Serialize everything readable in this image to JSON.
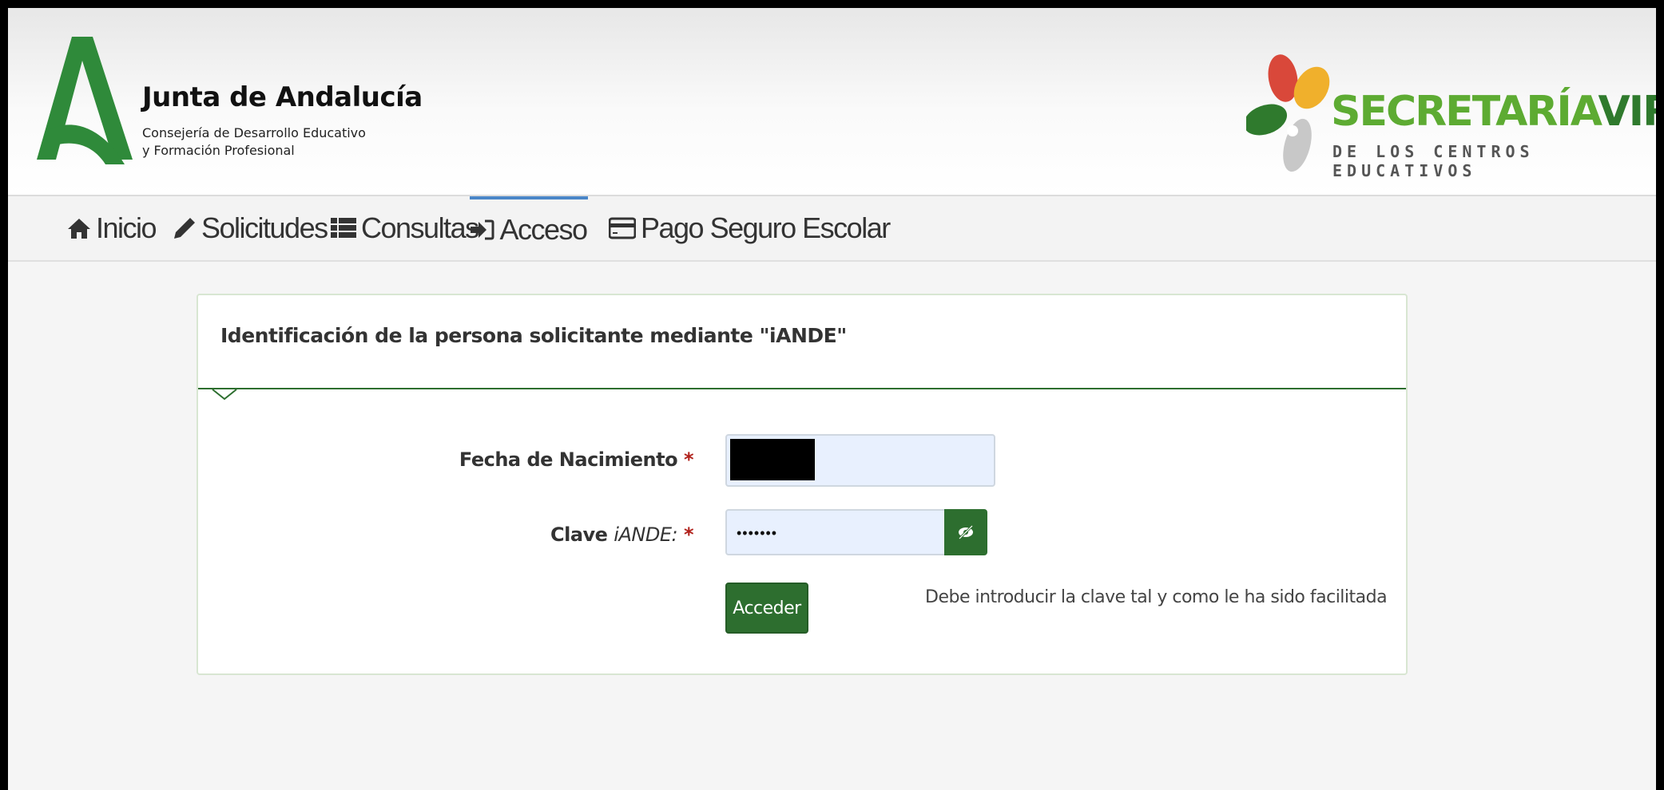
{
  "header": {
    "org_name": "Junta de Andalucía",
    "org_subtitle_line1": "Consejería de Desarrollo Educativo",
    "org_subtitle_line2": "y Formación Profesional",
    "brand_part1": "SECRETARÍA",
    "brand_part2": "VIRTUAL",
    "brand_subtitle": "DE LOS CENTROS EDUCATIVOS"
  },
  "nav": {
    "items": [
      {
        "label": "Inicio",
        "icon": "home-icon"
      },
      {
        "label": "Solicitudes",
        "icon": "pencil-icon"
      },
      {
        "label": "Consultas",
        "icon": "list-icon"
      },
      {
        "label": "Acceso",
        "icon": "sign-in-icon",
        "active": true
      },
      {
        "label": "Pago Seguro Escolar",
        "icon": "credit-card-icon"
      }
    ]
  },
  "form": {
    "title": "Identificación de la persona solicitante mediante \"iANDE\"",
    "birthdate_label": "Fecha de Nacimiento",
    "password_label_prefix": "Clave ",
    "password_label_em": "iANDE:",
    "required_mark": "*",
    "password_value": "•••••••",
    "submit_label": "Acceder",
    "hint": "Debe introducir la clave tal y como le ha sido facilitada"
  },
  "colors": {
    "primary_green": "#2d6e2f",
    "brand_light_green": "#5dab32",
    "active_tab_accent": "#4a86c8",
    "required_red": "#b0201a",
    "input_background": "#e8f0fe"
  }
}
